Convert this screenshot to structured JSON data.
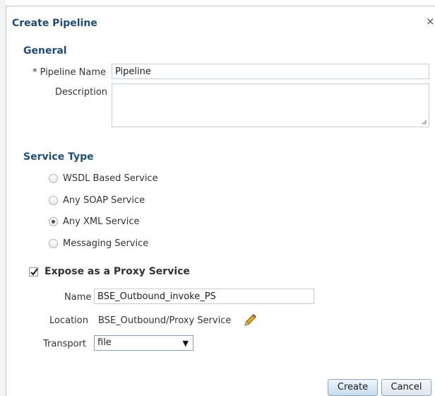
{
  "dialog": {
    "title": "Create Pipeline",
    "close_label": "×"
  },
  "general": {
    "heading": "General",
    "required_marker": "*",
    "pipeline_name_label": "Pipeline Name",
    "pipeline_name_value": "Pipeline",
    "description_label": "Description",
    "description_value": ""
  },
  "service_type": {
    "heading": "Service Type",
    "options": [
      {
        "label": "WSDL Based Service",
        "selected": false
      },
      {
        "label": "Any SOAP Service",
        "selected": false
      },
      {
        "label": "Any XML Service",
        "selected": true
      },
      {
        "label": "Messaging Service",
        "selected": false
      }
    ]
  },
  "proxy": {
    "checkbox_label": "Expose as a Proxy Service",
    "checked": true,
    "name_label": "Name",
    "name_value": "BSE_Outbound_invoke_PS",
    "location_label": "Location",
    "location_value": "BSE_Outbound/Proxy Service",
    "edit_icon": "pencil-icon",
    "transport_label": "Transport",
    "transport_value": "file"
  },
  "actions": {
    "create_label": "Create",
    "cancel_label": "Cancel"
  },
  "colors": {
    "heading": "#1f4e79",
    "pencil": "#e0a81c"
  }
}
